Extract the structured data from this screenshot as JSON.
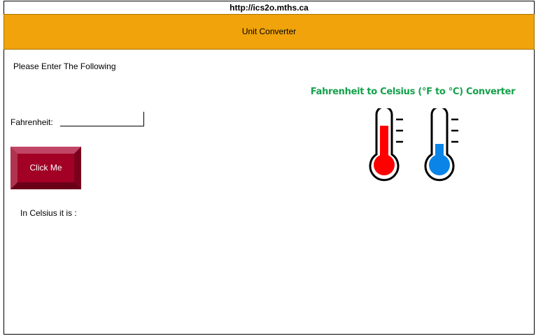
{
  "url": "http://ics2o.mths.ca",
  "header": {
    "title": "Unit Converter"
  },
  "form": {
    "prompt": "Please Enter The Following",
    "fahrenheit_label": "Fahrenheit:",
    "fahrenheit_value": "",
    "button_label": "Click Me",
    "result_text": "In Celsius it is :"
  },
  "illustration": {
    "title": "Fahrenheit to Celsius (°F to °C) Converter",
    "icons": [
      "hot-thermometer-icon",
      "cold-thermometer-icon"
    ],
    "colors": {
      "hot": "#ff0000",
      "cold": "#0a84e6",
      "title": "#14a14a"
    }
  },
  "colors": {
    "header": "#f0a30a",
    "button": "#a20025"
  }
}
